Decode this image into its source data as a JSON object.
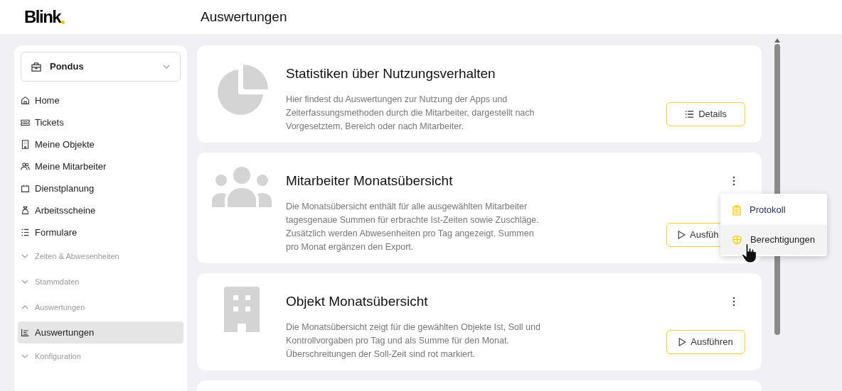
{
  "header": {
    "logo": "Blink",
    "title": "Auswertungen"
  },
  "sidebar": {
    "account": {
      "label": "Pondus"
    },
    "items": [
      {
        "kind": "link",
        "label": "Home",
        "selected": false
      },
      {
        "kind": "link",
        "label": "Tickets",
        "selected": false
      },
      {
        "kind": "link",
        "label": "Meine Objekte",
        "selected": false
      },
      {
        "kind": "link",
        "label": "Meine Mitarbeiter",
        "selected": false
      },
      {
        "kind": "link",
        "label": "Dienstplanung",
        "selected": false
      },
      {
        "kind": "link",
        "label": "Arbeitsscheine",
        "selected": false
      },
      {
        "kind": "link",
        "label": "Formulare",
        "selected": false
      },
      {
        "kind": "group",
        "label": "Zeiten & Abwesenheiten",
        "expanded": false
      },
      {
        "kind": "group",
        "label": "Stammdaten",
        "expanded": false
      },
      {
        "kind": "group",
        "label": "Auswertungen",
        "expanded": true,
        "children": [
          {
            "kind": "link",
            "label": "Auswertungen",
            "selected": true
          }
        ]
      },
      {
        "kind": "group",
        "label": "Konfiguration",
        "expanded": false
      }
    ]
  },
  "cards": [
    {
      "title": "Statistiken über Nutzungsverhalten",
      "description": "Hier findest du Auswertungen zur Nutzung der Apps und Zeiterfassungsmethoden durch die Mitarbeiter, dargestellt nach Vorgesetztem, Bereich oder nach Mitarbeiter.",
      "more_menu": false,
      "action": {
        "label": "Details"
      }
    },
    {
      "title": "Mitarbeiter Monatsübersicht",
      "description": "Die Monatsübersicht enthält für alle ausgewählten Mitarbeiter tagesgenaue Summen für erbrachte Ist-Zeiten sowie Zuschläge. Zusätzlich werden Abwesenheiten pro Tag angezeigt. Summen pro Monat ergänzen den Export.",
      "more_menu": true,
      "action": {
        "label": "Ausfüh"
      },
      "menu": [
        {
          "label": "Protokoll",
          "selected": false
        },
        {
          "label": "Berechtigungen",
          "selected": true
        }
      ]
    },
    {
      "title": "Objekt Monatsübersicht",
      "description": "Die Monatsübersicht zeigt für die gewählten Objekte Ist, Soll und Kontrollvorgaben pro Tag und als Summe für den Monat. Überschreitungen der Soll-Zeit sind rot markiert.",
      "more_menu": true,
      "action": {
        "label": "Ausführen"
      }
    }
  ]
}
